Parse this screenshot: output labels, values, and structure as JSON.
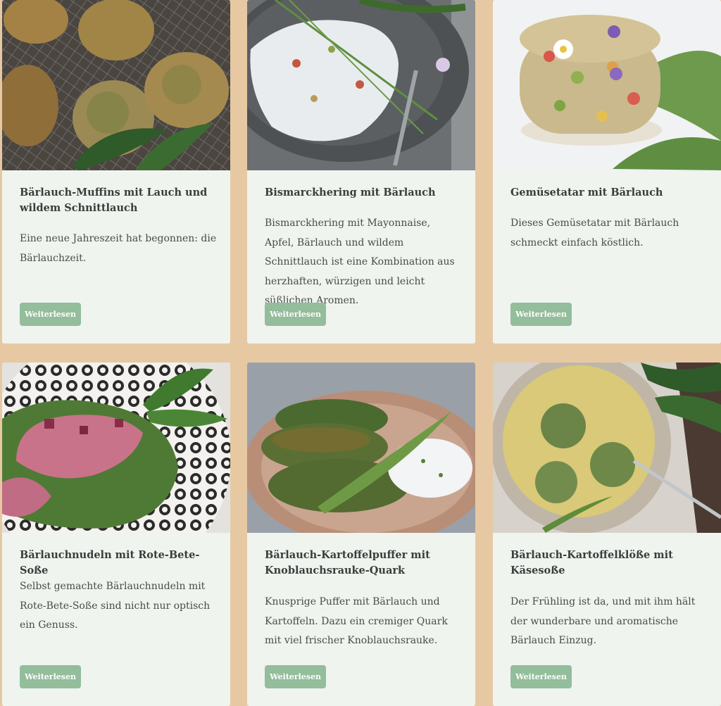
{
  "recipes": [
    {
      "title": "Bärlauch-Muffins mit Lauch und wildem Schnittlauch",
      "text": "Eine neue Jahreszeit hat begonnen: die Bärlauchzeit.",
      "button": "Weiterlesen",
      "image": "baerlauch-muffins-photo"
    },
    {
      "title": "Bismarckhering mit Bärlauch",
      "text": "Bismarckhering mit Mayonnaise, Apfel, Bärlauch und wildem Schnittlauch ist eine Kombination aus herzhaften, würzigen und leicht süßlichen Aromen.",
      "button": "Weiterlesen",
      "image": "bismarckhering-photo"
    },
    {
      "title": "Gemüsetatar mit Bärlauch",
      "text": "Dieses Gemüsetatar mit Bärlauch schmeckt einfach köstlich.",
      "button": "Weiterlesen",
      "image": "gemuesetatar-photo"
    },
    {
      "title": "Bärlauchnudeln mit Rote-Bete-Soße",
      "text": "Selbst gemachte Bärlauchnudeln mit Rote-Bete-Soße sind nicht nur optisch ein Genuss.",
      "button": "Weiterlesen",
      "image": "baerlauchnudeln-photo"
    },
    {
      "title": "Bärlauch-Kartoffelpuffer mit Knoblauchsrauke-Quark",
      "text": "Knusprige Puffer mit Bärlauch und Kartoffeln. Dazu ein cremiger Quark mit viel frischer Knoblauchsrauke.",
      "button": "Weiterlesen",
      "image": "kartoffelpuffer-photo"
    },
    {
      "title": "Bärlauch-Kartoffelklöße mit Käsesoße",
      "text": "Der Frühling ist da, und mit ihm hält der wunderbare und aromatische Bärlauch Einzug.",
      "button": "Weiterlesen",
      "image": "kartoffelkloesse-photo"
    }
  ],
  "colors": {
    "page_bg": "#e6c9a3",
    "card_bg": "#eff4ef",
    "button_bg": "#93bd9b",
    "title": "#3c3c3c"
  }
}
